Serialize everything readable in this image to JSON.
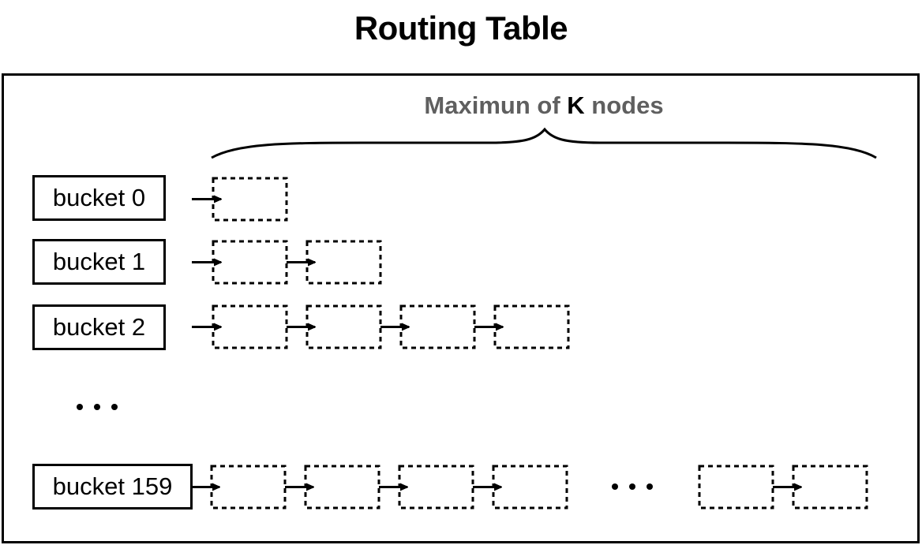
{
  "title": "Routing Table",
  "capacity_label": {
    "prefix": "Maximun of ",
    "emphasis": "K",
    "suffix": " nodes"
  },
  "buckets": [
    {
      "label": "bucket 0",
      "node_count": 1
    },
    {
      "label": "bucket 1",
      "node_count": 2
    },
    {
      "label": "bucket 2",
      "node_count": 4
    },
    {
      "label": "bucket 159",
      "node_count": "K",
      "visible_nodes_before_gap": 4,
      "visible_nodes_after_gap": 2
    }
  ],
  "rows_omitted_indicator": "...",
  "nodes_omitted_indicator": "...",
  "colors": {
    "title": "#000000",
    "subtitle": "#5f5f5f",
    "emphasis": "#000000",
    "stroke": "#000000"
  }
}
